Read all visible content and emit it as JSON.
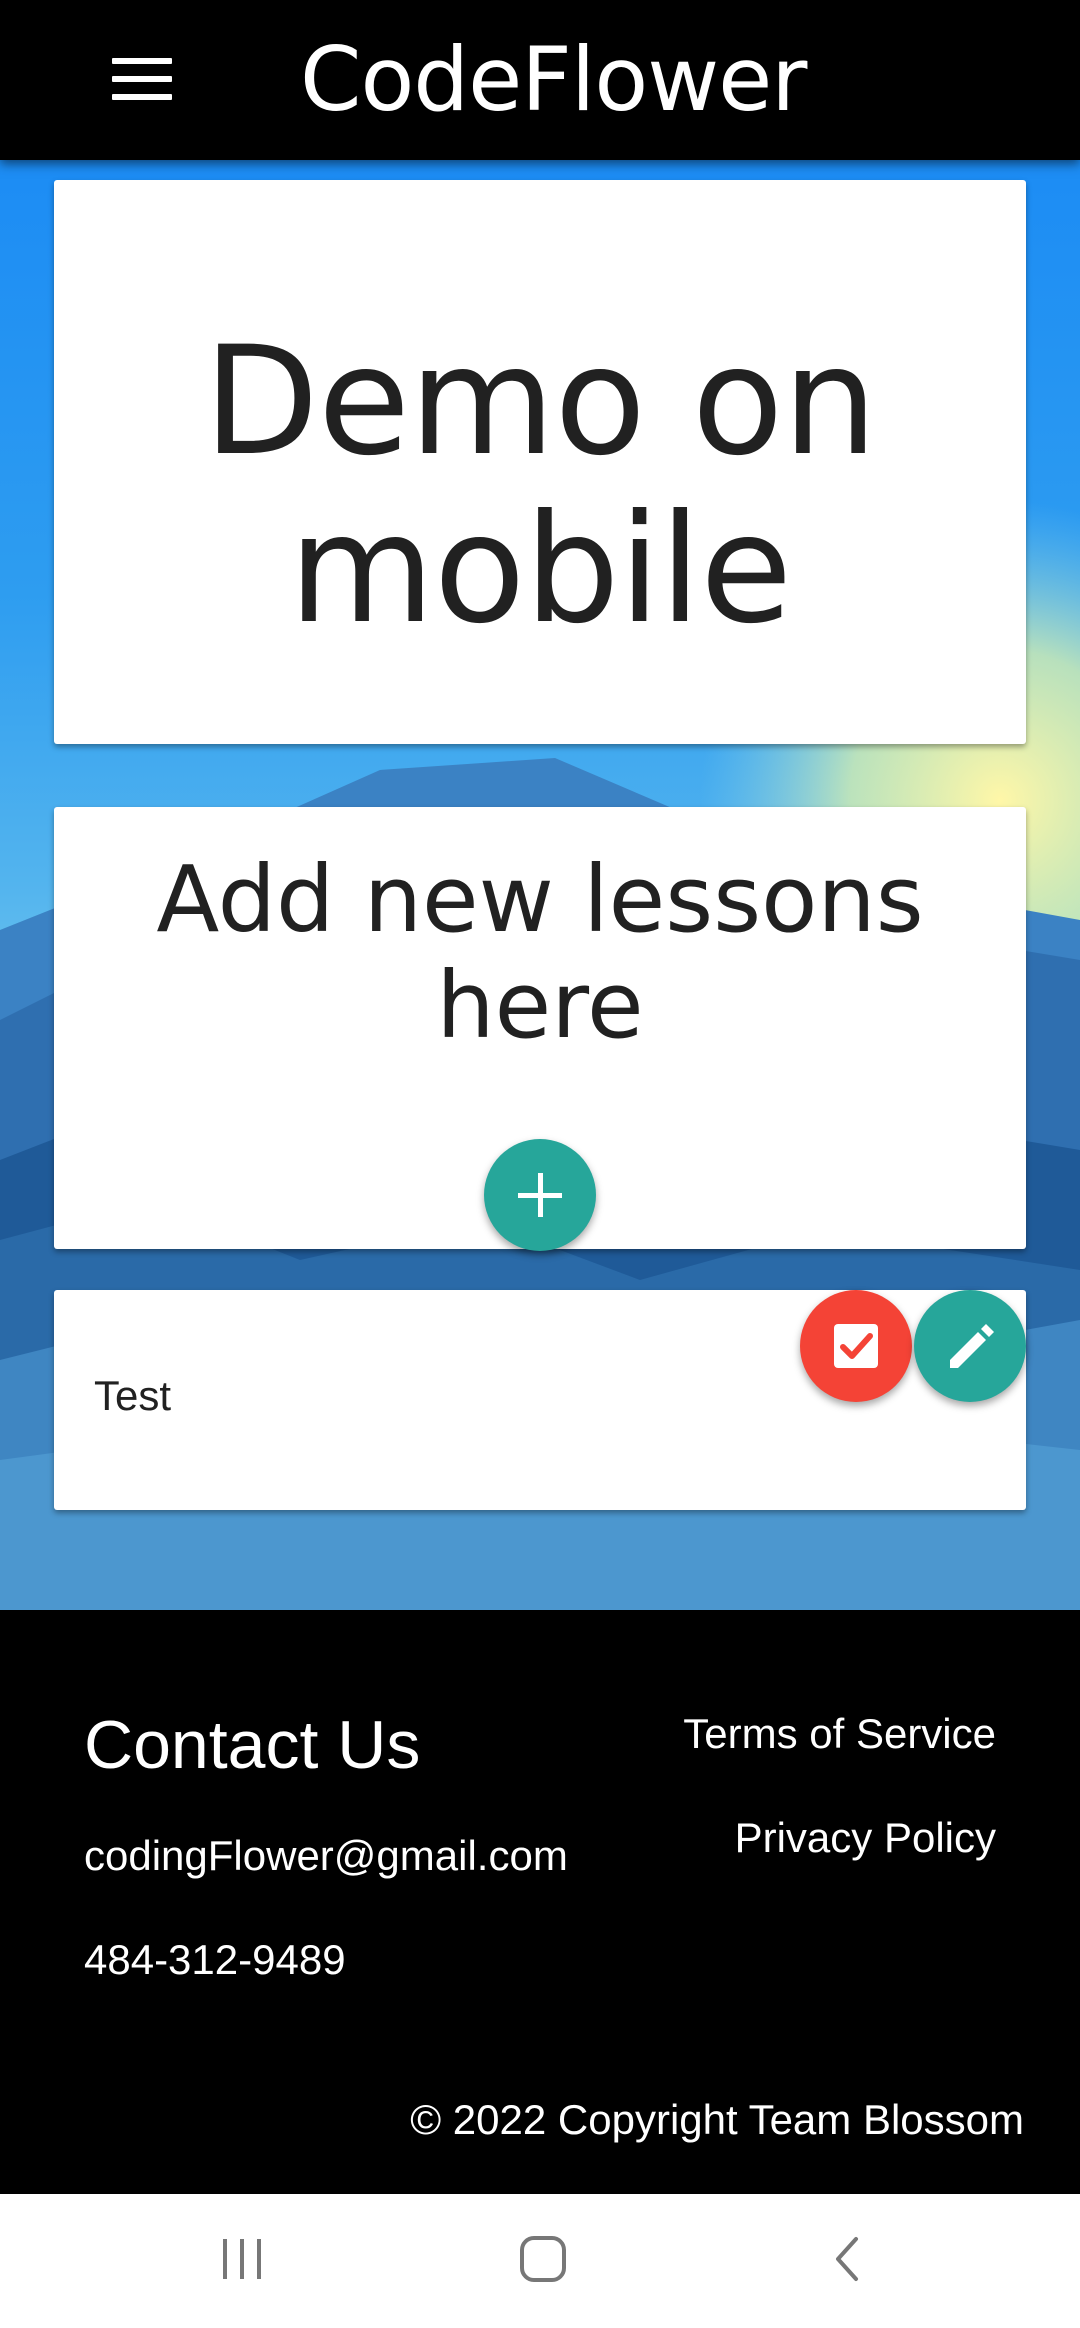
{
  "app": {
    "title": "CodeFlower"
  },
  "hero": {
    "text": "Demo on mobile"
  },
  "add_card": {
    "text": "Add new lessons here"
  },
  "lessons": [
    {
      "label": "Test"
    }
  ],
  "footer": {
    "contact_title": "Contact Us",
    "email": "codingFlower@gmail.com",
    "phone": "484-312-9489",
    "terms_link": "Terms of Service",
    "privacy_link": "Privacy Policy",
    "copyright": "© 2022 Copyright Team Blossom"
  },
  "icons": {
    "menu": "hamburger-menu-icon",
    "add": "plus-icon",
    "check": "checkbox-checked-icon",
    "edit": "pencil-icon",
    "nav_recents": "recents-icon",
    "nav_home": "home-icon",
    "nav_back": "back-icon"
  },
  "colors": {
    "appbar": "#000000",
    "fab_teal": "#26a69a",
    "fab_red": "#f44336",
    "footer": "#000000"
  }
}
